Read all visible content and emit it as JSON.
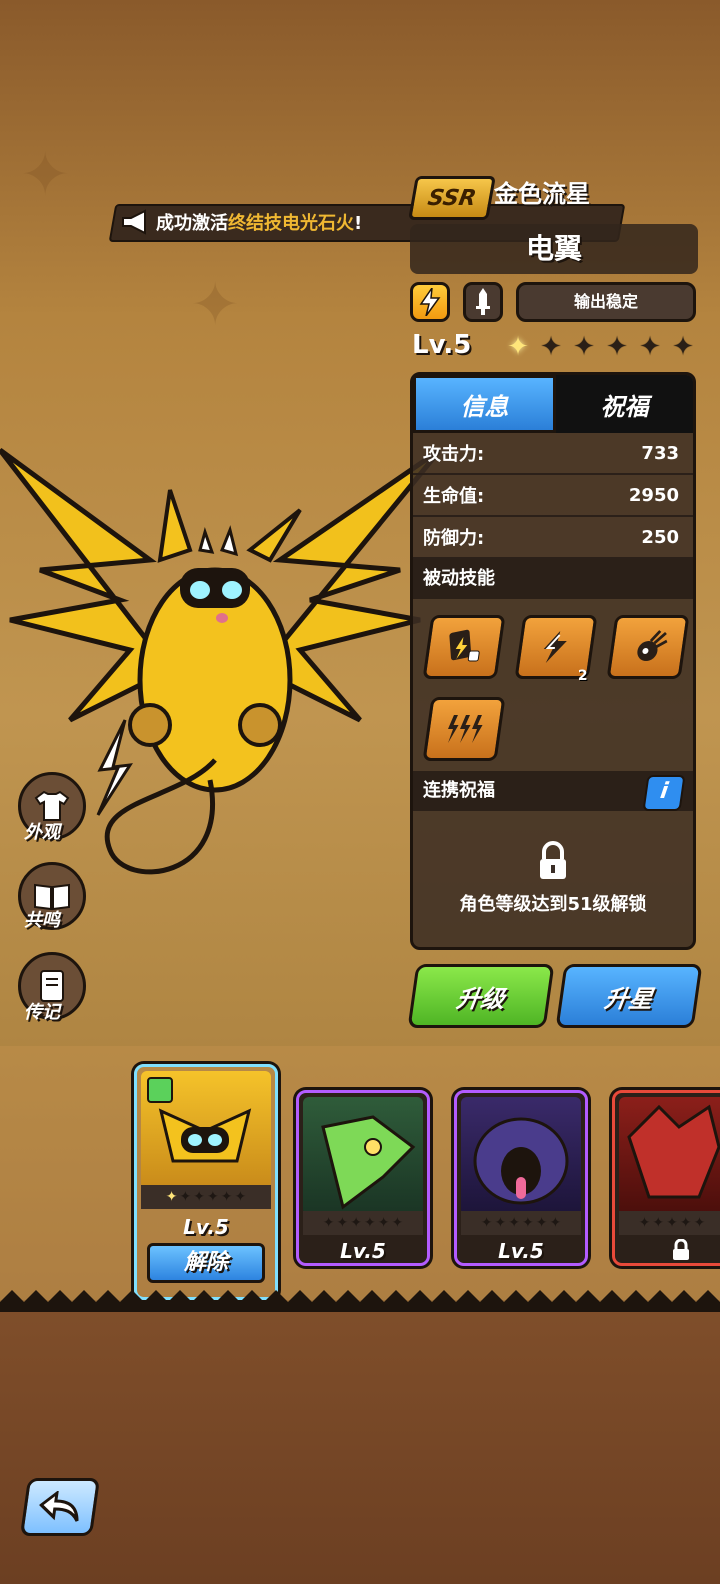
{
  "banner": {
    "prefix": "成功激活",
    "highlight": "终结技电光石火",
    "suffix": "!"
  },
  "hero": {
    "rarity": "SSR",
    "rarity_name": "金色流星",
    "name": "电翼",
    "tag_label": "输出稳定",
    "level": "Lv.5",
    "stars_filled": 1,
    "stars_total": 6
  },
  "tabs": [
    {
      "label": "信息",
      "active": true
    },
    {
      "label": "祝福",
      "active": false
    }
  ],
  "stats": [
    {
      "label": "攻击力:",
      "value": "733"
    },
    {
      "label": "生命值:",
      "value": "2950"
    },
    {
      "label": "防御力:",
      "value": "250"
    }
  ],
  "passive": {
    "title": "被动技能",
    "skills": [
      {
        "icon": "lightning-card-icon",
        "count": ""
      },
      {
        "icon": "lightning-bolt-icon",
        "count": "2"
      },
      {
        "icon": "fireball-icon",
        "count": ""
      },
      {
        "icon": "triple-lightning-icon",
        "count": ""
      }
    ]
  },
  "link_blessing": {
    "title": "连携祝福",
    "info_label": "i",
    "lock_text": "角色等级达到51级解锁"
  },
  "actions": {
    "upgrade": "升级",
    "star_up": "升星"
  },
  "side_menu": [
    {
      "label": "外观",
      "icon": "shirt-icon"
    },
    {
      "label": "共鸣",
      "icon": "book-icon"
    },
    {
      "label": "传记",
      "icon": "journal-icon"
    }
  ],
  "roster": [
    {
      "level": "Lv.5",
      "button": "解除",
      "frame_color": "#7fe0ff",
      "stars_filled": 1,
      "stars_total": 6
    },
    {
      "level": "Lv.5",
      "frame_color": "#b35cff",
      "stars_filled": 0,
      "stars_total": 6
    },
    {
      "level": "Lv.5",
      "frame_color": "#b35cff",
      "stars_filled": 0,
      "stars_total": 6
    },
    {
      "level": "",
      "locked": true,
      "frame_color": "#e84a3a",
      "stars_filled": 0,
      "stars_total": 6
    }
  ],
  "colors": {
    "accent_blue": "#2f8ef0",
    "upgrade_green": "#6bd13c",
    "gold": "#f0b832"
  }
}
